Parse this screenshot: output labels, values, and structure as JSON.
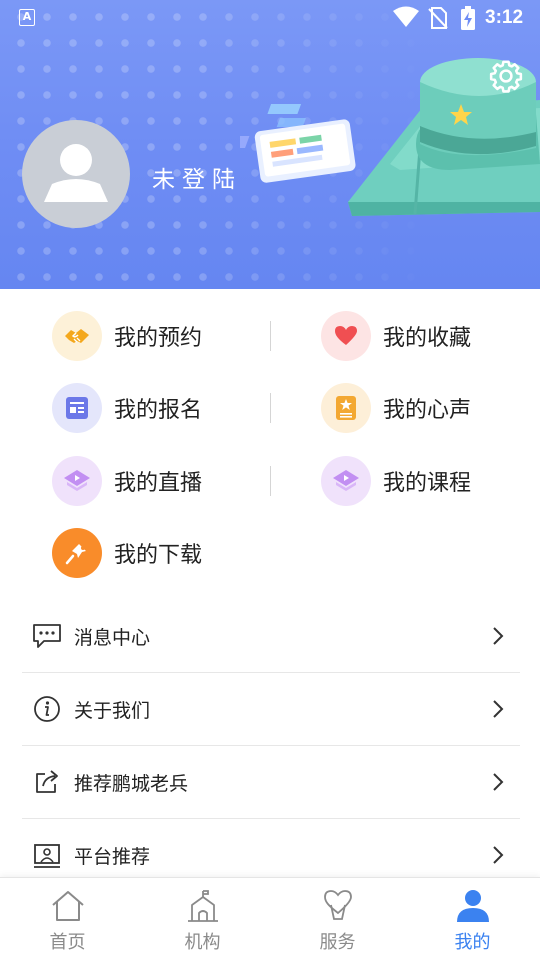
{
  "status_bar": {
    "time": "3:12",
    "keyboard_indicator": "A"
  },
  "profile": {
    "login_status": "未登陆",
    "avatar_icon": "user-avatar-icon",
    "settings_icon": "gear-icon"
  },
  "grid": [
    {
      "label": "我的预约",
      "icon": "handshake-icon",
      "bg": "#fdf1d8",
      "color": "#f4a81d"
    },
    {
      "label": "我的收藏",
      "icon": "heart-icon",
      "bg": "#fde4e4",
      "color": "#f04f52"
    },
    {
      "label": "我的报名",
      "icon": "form-icon",
      "bg": "#e4e6fb",
      "color": "#6c78e8"
    },
    {
      "label": "我的心声",
      "icon": "note-star-icon",
      "bg": "#fdefd8",
      "color": "#f3a832"
    },
    {
      "label": "我的直播",
      "icon": "live-play-icon",
      "bg": "#f0e2fb",
      "color": "#c28ff2"
    },
    {
      "label": "我的课程",
      "icon": "course-play-icon",
      "bg": "#f0e2fb",
      "color": "#c28ff2"
    },
    {
      "label": "我的下载",
      "icon": "download-icon",
      "bg": "#f98c2a",
      "color": "#ffffff"
    }
  ],
  "list": [
    {
      "label": "消息中心",
      "icon": "message-icon"
    },
    {
      "label": "关于我们",
      "icon": "info-icon"
    },
    {
      "label": "推荐鹏城老兵",
      "icon": "share-icon"
    },
    {
      "label": "平台推荐",
      "icon": "platform-icon"
    }
  ],
  "nav": [
    {
      "label": "首页",
      "icon": "home-icon",
      "active": false
    },
    {
      "label": "机构",
      "icon": "institution-icon",
      "active": false
    },
    {
      "label": "服务",
      "icon": "service-heart-icon",
      "active": false
    },
    {
      "label": "我的",
      "icon": "profile-icon",
      "active": true
    }
  ],
  "colors": {
    "header": "#7b98f6",
    "accent": "#3b82f0",
    "nav_inactive": "#8a8a8a"
  }
}
